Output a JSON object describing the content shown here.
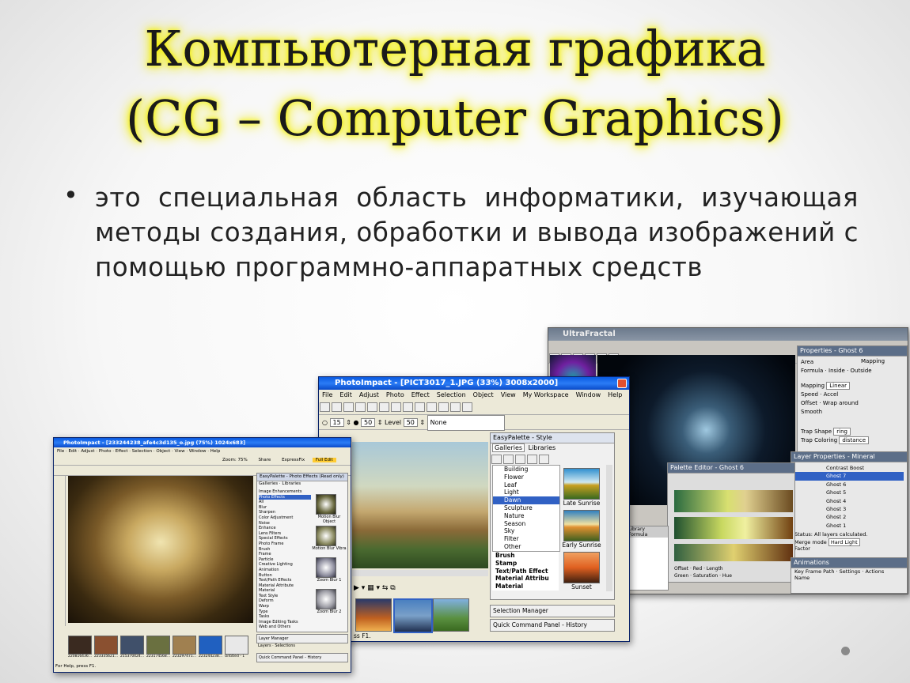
{
  "slide": {
    "title_line1": "Компьютерная графика",
    "title_line2": "(CG – Computer Graphics)",
    "bullet_symbol": "•",
    "bullet_text": "это специальная область информатики, изучающая методы создания, обработки и вывода изображений с помощью программно-аппаратных средств",
    "highlight_color": "#f4f000"
  },
  "photoimpact_window": {
    "title": "PhotoImpact - [PICT3017_1.JPG (33%) 3008x2000]",
    "menu": [
      "File",
      "Edit",
      "Adjust",
      "Photo",
      "Effect",
      "Selection",
      "Object",
      "View",
      "My Workspace",
      "Window",
      "Help"
    ],
    "brush_size": "15",
    "opacity": "50",
    "level_label": "Level",
    "level_value": "50",
    "style_value": "None",
    "palette_title": "EasyPalette - Style",
    "palette_tabs": [
      "Galleries",
      "Libraries"
    ],
    "categories": [
      "Building",
      "Flower",
      "Leaf",
      "Light",
      "Dawn",
      "Sculpture",
      "Nature",
      "Season",
      "Sky",
      "Filter",
      "Other"
    ],
    "selected_category": "Dawn",
    "tree_items": [
      "Brush",
      "Stamp",
      "Text/Path Effect",
      "Material Attribu",
      "Material"
    ],
    "swatches": [
      "Late Sunrise",
      "Early Sunrise",
      "Sunset"
    ],
    "bottom_panels": [
      "Selection Manager",
      "Quick Command Panel - History"
    ],
    "status_text": "ss F1."
  },
  "small_window": {
    "title": "PhotoImpact - [233244238_afe4c3d135_o.jpg (75%) 1024x683]",
    "palette_title": "EasyPalette - Photo Effects (Read only)",
    "tabs": [
      "Galleries",
      "Libraries"
    ],
    "tree": [
      "Image Enhancements",
      "Photo Effects",
      "All",
      "Blur",
      "Sharpen",
      "Color Adjustment",
      "Noise",
      "Enhance",
      "Lens Filters",
      "Special Effects",
      "Photo Frame",
      "Brush",
      "Frame",
      "Particle",
      "Creative Lighting",
      "Animation",
      "Button",
      "Text/Path Effects",
      "Material Attribute",
      "Material",
      "Text Style",
      "Deform",
      "Warp",
      "Type",
      "Tasks",
      "Image Editing Tasks",
      "Web and Others"
    ],
    "thumb_captions": [
      "Motion Blur Object",
      "Motion Blur Vibra",
      "Zoom Blur 1",
      "Zoom Blur 2"
    ],
    "filmstrip_captions": [
      "220816436...",
      "223335621...",
      "215370424...",
      "223174568...",
      "223297471...",
      "223244238...",
      "Untitled - 1"
    ],
    "panels": [
      "Layer Manager",
      "Quick Command Panel - History"
    ],
    "bottom_tabs": [
      "Layers",
      "Selections"
    ],
    "zoom_label": "Zoom: 75%",
    "share_label": "Share",
    "mode_label": "ExpressFix",
    "fulledit_label": "Full Edit",
    "status_text": "For Help, press F1."
  },
  "fractal_window": {
    "title": "UltraFractal",
    "properties_title": "Properties - Ghost 6",
    "tabs": [
      "Area",
      "Mapping",
      "Formula",
      "Inside",
      "Outside"
    ],
    "fields": [
      "Mapping",
      "Speed",
      "Offset",
      "Accel",
      "Smooth"
    ],
    "mapping_value": "Linear",
    "wrap_label": "Wrap around",
    "trap_shape_label": "Trap Shape",
    "trap_shape_value": "ring",
    "trap_coloring_label": "Trap Coloring",
    "trap_coloring_value": "distance",
    "layer_props_title": "Layer Properties - Mineral",
    "layers": [
      "Contrast Boost",
      "Ghost 7",
      "Ghost 6",
      "Ghost 5",
      "Ghost 4",
      "Ghost 3",
      "Ghost 2",
      "Ghost 1"
    ],
    "status_text": "Status: All layers calculated.",
    "merge_label": "Merge mode",
    "merge_value": "Hard Light",
    "factor_label": "Factor",
    "palette_editor_title": "Palette Editor - Ghost 6",
    "animations_title": "Animations",
    "keyframe_label": "Key Frame Path",
    "settings_label": "Settings",
    "name_label": "Name",
    "actions_label": "Actions",
    "offset_label": "Offset",
    "red_label": "Red",
    "green_label": "Green",
    "length_label": "Length",
    "saturation_label": "Saturation",
    "hue_label": "Hue",
    "library_label": "Library",
    "formula_label": "Formula"
  }
}
